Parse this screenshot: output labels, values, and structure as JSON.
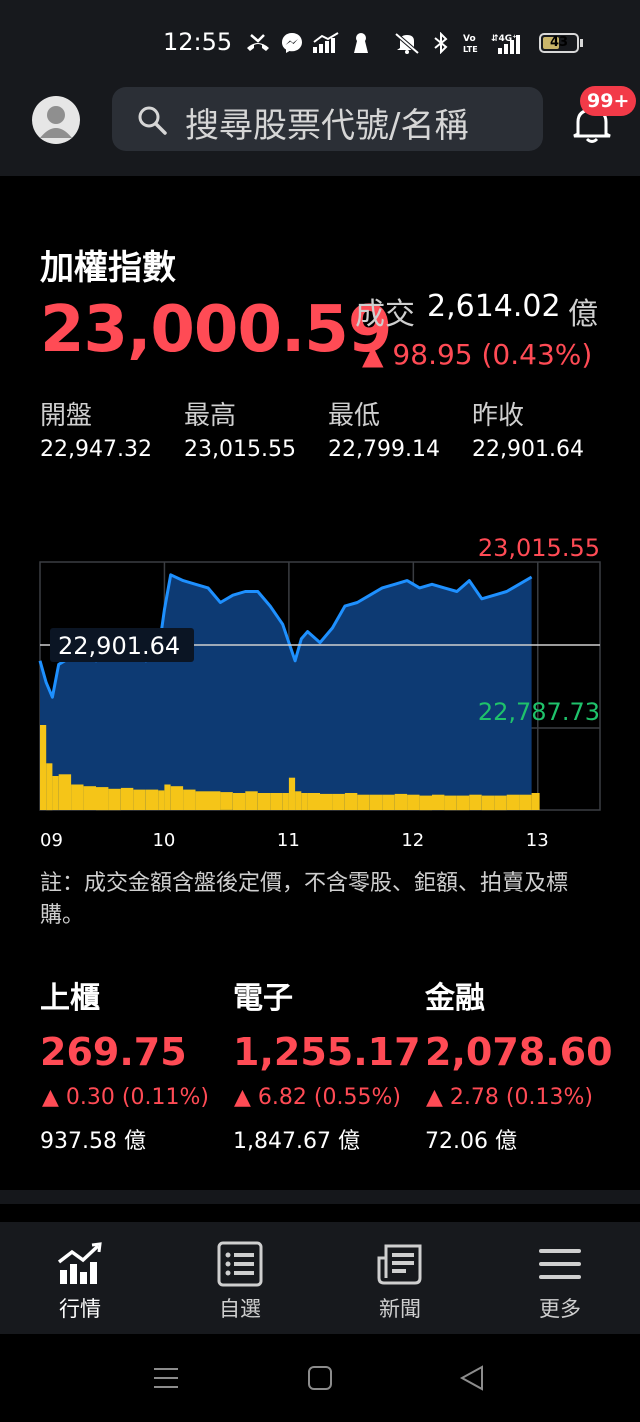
{
  "status_bar": {
    "time": "12:55",
    "battery": "43",
    "icons": [
      "missed-call-icon",
      "messenger-icon",
      "signal-bars-icon",
      "keyhole-icon",
      "mute-icon",
      "bluetooth-icon",
      "volte-icon",
      "mobile-data-4g-icon",
      "battery-icon"
    ]
  },
  "header": {
    "search_placeholder": "搜尋股票代號/名稱",
    "badge": "99+"
  },
  "index": {
    "name": "加權指數",
    "value": "23,000.59",
    "turnover_label": "成交",
    "turnover_value": "2,614.02",
    "turnover_unit": "億",
    "change": "▲ 98.95 (0.43%)",
    "stats": [
      {
        "label": "開盤",
        "value": "22,947.32"
      },
      {
        "label": "最高",
        "value": "23,015.55"
      },
      {
        "label": "最低",
        "value": "22,799.14"
      },
      {
        "label": "昨收",
        "value": "22,901.64"
      }
    ]
  },
  "chart_data": {
    "type": "area",
    "x_ticks": [
      "09",
      "10",
      "11",
      "12",
      "13"
    ],
    "ylim": [
      22787.73,
      23015.55
    ],
    "high_label": "23,015.55",
    "low_label": "22,787.73",
    "ref_label": "22,901.64",
    "ref_value": 22901.64,
    "x": [
      9.0,
      9.05,
      9.1,
      9.15,
      9.25,
      9.35,
      9.45,
      9.55,
      9.65,
      9.75,
      9.85,
      9.95,
      10.0,
      10.05,
      10.15,
      10.25,
      10.35,
      10.45,
      10.55,
      10.65,
      10.75,
      10.85,
      10.95,
      11.0,
      11.05,
      11.1,
      11.15,
      11.25,
      11.35,
      11.45,
      11.55,
      11.65,
      11.75,
      11.85,
      11.95,
      12.05,
      12.15,
      12.25,
      12.35,
      12.45,
      12.55,
      12.65,
      12.75,
      12.85,
      12.95
    ],
    "y": [
      22880,
      22850,
      22830,
      22875,
      22885,
      22890,
      22880,
      22885,
      22895,
      22900,
      22880,
      22890,
      22950,
      22998,
      22990,
      22985,
      22980,
      22960,
      22970,
      22975,
      22975,
      22955,
      22930,
      22905,
      22880,
      22910,
      22920,
      22905,
      22925,
      22955,
      22960,
      22970,
      22980,
      22985,
      22990,
      22980,
      22985,
      22980,
      22975,
      22990,
      22965,
      22970,
      22975,
      22985,
      22995
    ],
    "volume_ticks": [
      1.0,
      0.55,
      0.4,
      0.42,
      0.3,
      0.28,
      0.27,
      0.25,
      0.26,
      0.24,
      0.24,
      0.23,
      0.3,
      0.28,
      0.24,
      0.22,
      0.22,
      0.21,
      0.2,
      0.22,
      0.2,
      0.2,
      0.2,
      0.38,
      0.22,
      0.2,
      0.2,
      0.19,
      0.19,
      0.2,
      0.18,
      0.18,
      0.18,
      0.19,
      0.18,
      0.17,
      0.18,
      0.17,
      0.17,
      0.18,
      0.17,
      0.17,
      0.18,
      0.18,
      0.2
    ],
    "colors": {
      "line": "#1e90ff",
      "area": "#0d3a73",
      "volume": "#f5c518",
      "high": "#ff4b55",
      "low": "#1fc26b",
      "grid": "#3a3d42"
    }
  },
  "footnote": "註：成交金額含盤後定價，不含零股、鉅額、拍賣及標購。",
  "sub_indices": [
    {
      "name": "上櫃",
      "value": "269.75",
      "change": "▲ 0.30 (0.11%)",
      "volume": "937.58 億"
    },
    {
      "name": "電子",
      "value": "1,255.17",
      "change": "▲ 6.82 (0.55%)",
      "volume": "1,847.67 億"
    },
    {
      "name": "金融",
      "value": "2,078.60",
      "change": "▲ 2.78 (0.13%)",
      "volume": "72.06 億"
    }
  ],
  "bottom_nav": [
    {
      "label": "行情",
      "icon": "quotes-chart-icon",
      "active": true
    },
    {
      "label": "自選",
      "icon": "watchlist-icon",
      "active": false
    },
    {
      "label": "新聞",
      "icon": "news-icon",
      "active": false
    },
    {
      "label": "更多",
      "icon": "menu-icon",
      "active": false
    }
  ],
  "system_nav": [
    "recent-apps-icon",
    "home-icon",
    "back-icon"
  ]
}
